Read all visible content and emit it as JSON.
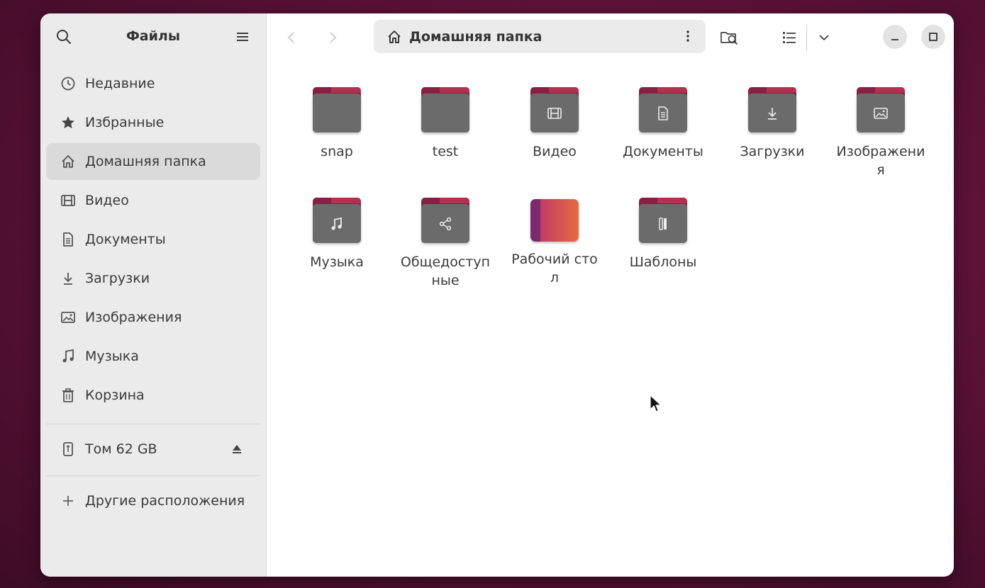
{
  "window": {
    "sidebar": {
      "title": "Файлы",
      "items": [
        {
          "label": "Недавние",
          "icon": "clock-icon"
        },
        {
          "label": "Избранные",
          "icon": "star-icon"
        },
        {
          "label": "Домашняя папка",
          "icon": "home-icon",
          "active": true
        },
        {
          "label": "Видео",
          "icon": "film-icon"
        },
        {
          "label": "Документы",
          "icon": "document-icon"
        },
        {
          "label": "Загрузки",
          "icon": "download-icon"
        },
        {
          "label": "Изображения",
          "icon": "image-icon"
        },
        {
          "label": "Музыка",
          "icon": "music-icon"
        },
        {
          "label": "Корзина",
          "icon": "trash-icon"
        }
      ],
      "volume": {
        "label": "Том 62 GB",
        "icon": "usb-drive-icon"
      },
      "other_locations": {
        "label": "Другие расположения",
        "icon": "plus-icon"
      }
    },
    "pathbar": {
      "label": "Домашняя папка",
      "icon": "home-icon"
    },
    "files": [
      {
        "name": "snap",
        "emblem": ""
      },
      {
        "name": "test",
        "emblem": ""
      },
      {
        "name": "Видео",
        "emblem": "film-icon"
      },
      {
        "name": "Документы",
        "emblem": "document-icon"
      },
      {
        "name": "Загрузки",
        "emblem": "download-icon"
      },
      {
        "name": "Изображения",
        "emblem": "image-icon"
      },
      {
        "name": "Музыка",
        "emblem": "music-icon"
      },
      {
        "name": "Общедоступные",
        "emblem": "share-icon"
      },
      {
        "name": "Рабочий стол",
        "emblem": "desktop-icon"
      },
      {
        "name": "Шаблоны",
        "emblem": "template-icon"
      }
    ],
    "colors": {
      "accent_folder": "#8a1e43",
      "folder_body": "#6b6b6b",
      "sidebar_bg": "#ebebeb",
      "desktop_bg": "#5e1238"
    }
  }
}
